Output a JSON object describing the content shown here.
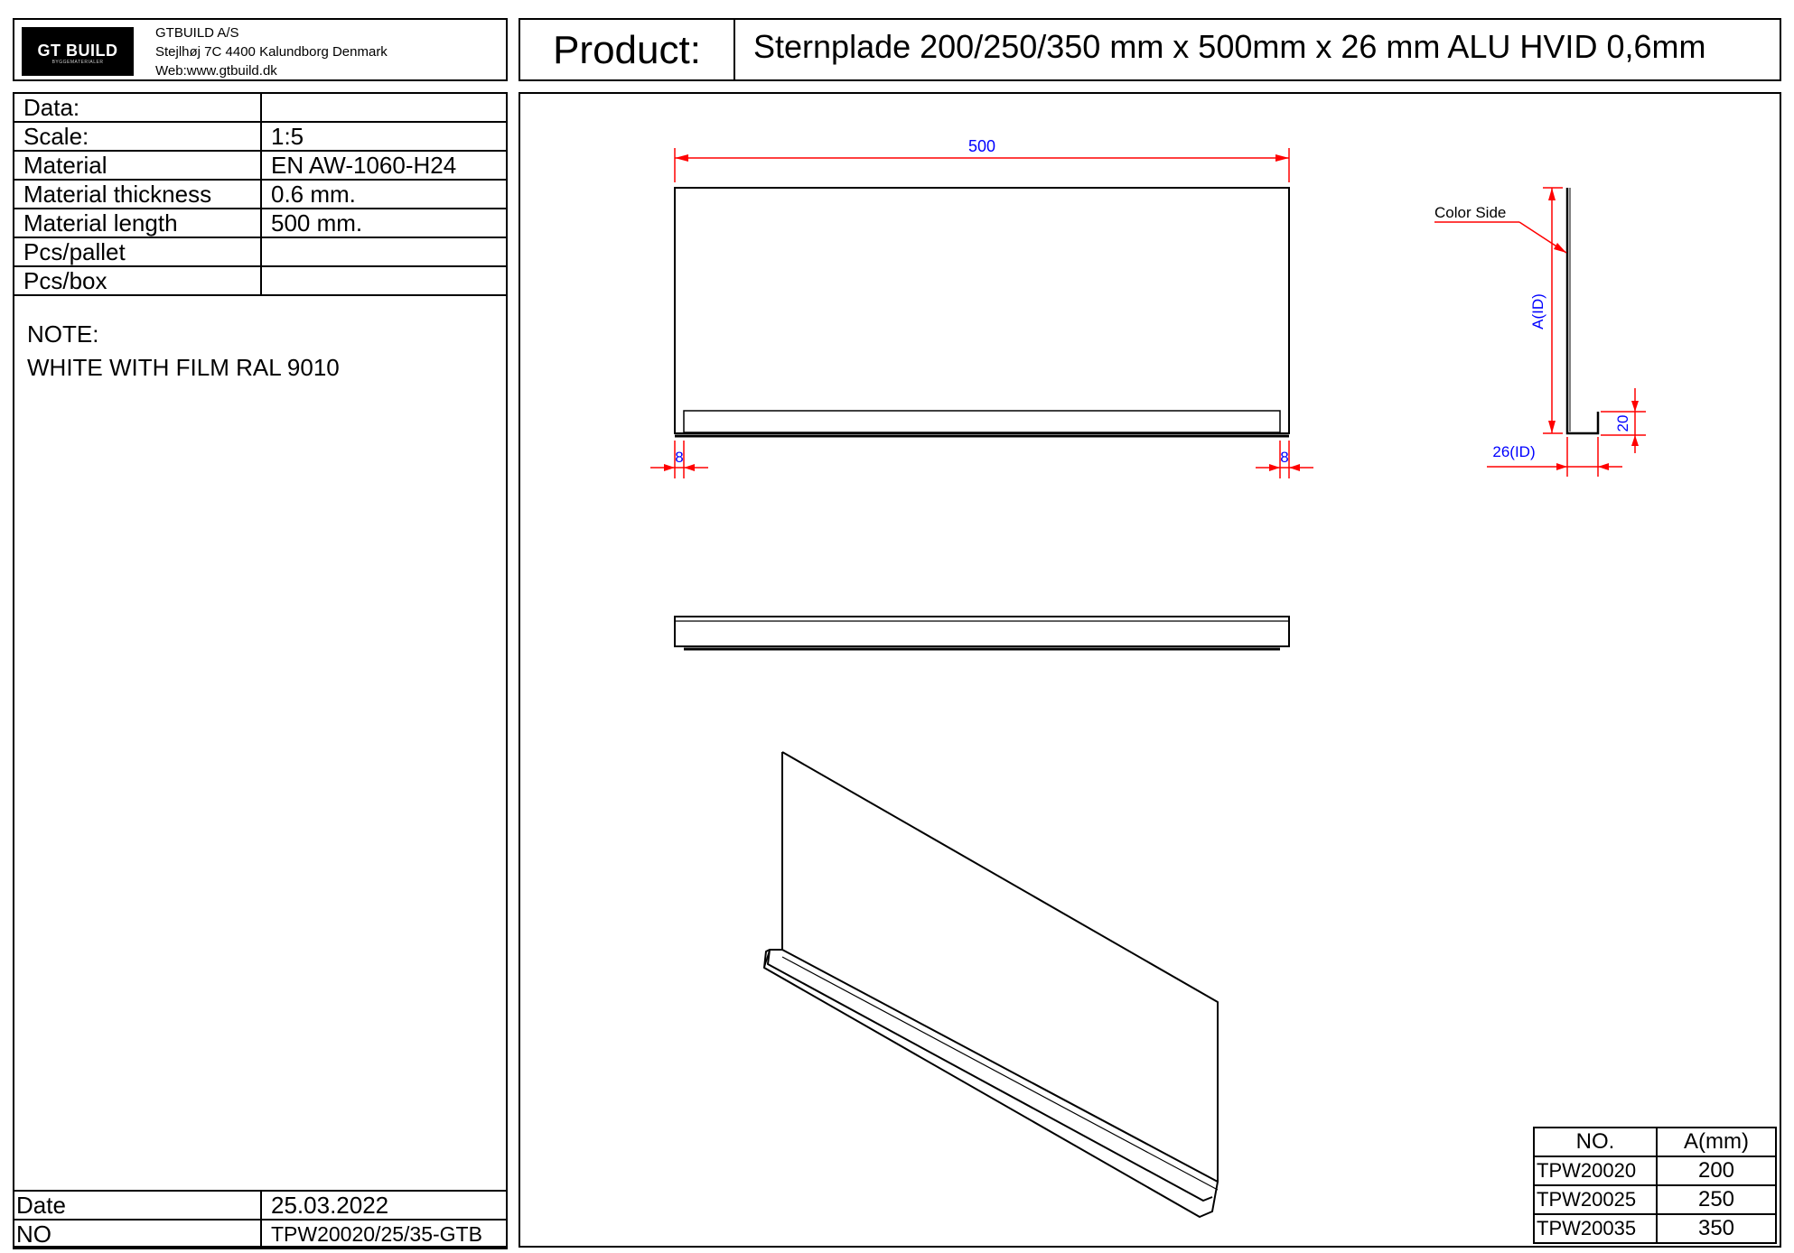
{
  "header": {
    "logo": {
      "main": "GT BUILD",
      "sub": "BYGGEMATERIALER"
    },
    "company": {
      "name": "GTBUILD A/S",
      "address": "Stejlhøj 7C 4400 Kalundborg Denmark",
      "web": "Web:www.gtbuild.dk"
    },
    "product_label": "Product:",
    "product_name": "Sternplade 200/250/350 mm x 500mm x 26 mm ALU HVID 0,6mm"
  },
  "info_table": [
    {
      "label": "Data:",
      "value": ""
    },
    {
      "label": "Scale:",
      "value": "1:5"
    },
    {
      "label": "Material",
      "value": "EN AW-1060-H24"
    },
    {
      "label": "Material thickness",
      "value": "0.6 mm."
    },
    {
      "label": "Material length",
      "value": "500 mm."
    },
    {
      "label": "Pcs/pallet",
      "value": ""
    },
    {
      "label": "Pcs/box",
      "value": ""
    }
  ],
  "note": {
    "title": "NOTE:",
    "text": "WHITE WITH FILM RAL 9010"
  },
  "footer": {
    "date_label": "Date",
    "date_value": "25.03.2022",
    "no_label": "NO",
    "no_value": "TPW20020/25/35-GTB"
  },
  "drawing": {
    "dim_length": "500",
    "dim_left_offset": "8",
    "dim_right_offset": "8",
    "color_side_label": "Color Side",
    "dim_height": "A(ID)",
    "dim_flange": "20",
    "dim_width": "26(ID)",
    "colors": {
      "dimension_line": "#ff0000",
      "dimension_text": "#0000ff",
      "outline": "#000000"
    }
  },
  "variants": {
    "headers": [
      "NO.",
      "A(mm)"
    ],
    "rows": [
      {
        "no": "TPW20020",
        "a": "200"
      },
      {
        "no": "TPW20025",
        "a": "250"
      },
      {
        "no": "TPW20035",
        "a": "350"
      }
    ]
  }
}
